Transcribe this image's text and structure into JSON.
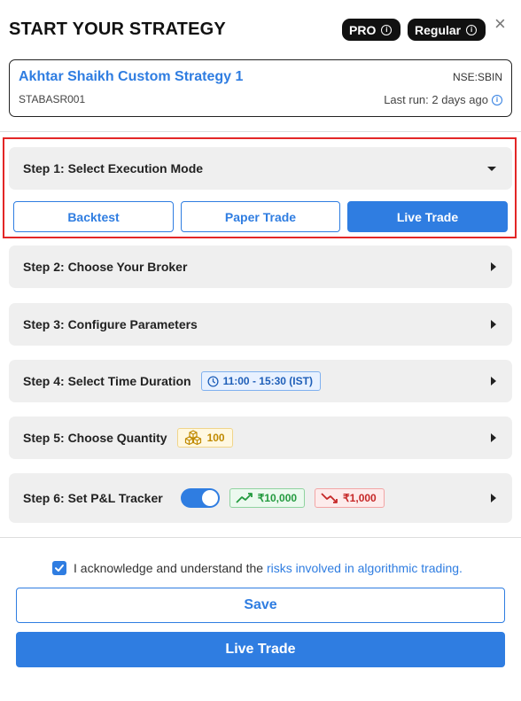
{
  "header": {
    "title": "START YOUR STRATEGY",
    "badge_pro": "PRO",
    "badge_regular": "Regular",
    "info_glyph": "i",
    "close_glyph": "×"
  },
  "strategy": {
    "name": "Akhtar Shaikh Custom Strategy 1",
    "symbol": "NSE:SBIN",
    "code": "STABASR001",
    "last_run": "Last run: 2 days ago"
  },
  "steps": {
    "step1": {
      "label": "Step 1: Select Execution Mode",
      "expanded": true
    },
    "step2": {
      "label": "Step 2: Choose Your Broker"
    },
    "step3": {
      "label": "Step 3: Configure Parameters"
    },
    "step4": {
      "label": "Step 4: Select Time Duration",
      "time_range": "11:00 - 15:30 (IST)"
    },
    "step5": {
      "label": "Step 5: Choose Quantity",
      "quantity": "100"
    },
    "step6": {
      "label": "Step 6: Set P&L Tracker",
      "tracker_enabled": true,
      "profit_target": "₹10,000",
      "stop_loss": "₹1,000"
    }
  },
  "execution_modes": {
    "backtest": "Backtest",
    "paper_trade": "Paper Trade",
    "live_trade": "Live Trade",
    "selected": "Live Trade"
  },
  "acknowledgement": {
    "checked": true,
    "text": "I acknowledge and understand the",
    "link_text": "risks involved in algorithmic trading."
  },
  "actions": {
    "save_label": "Save",
    "live_trade_label": "Live Trade"
  },
  "colors": {
    "accent": "#2f7de1",
    "highlight_border": "#e32626",
    "profit": "#239a3f",
    "loss": "#c62828",
    "quantity": "#c08a00"
  },
  "icons": {
    "close": "close-icon",
    "info": "info-icon",
    "clock": "clock-icon",
    "boxes": "boxes-icon",
    "trend_up": "trend-up-icon",
    "trend_down": "trend-down-icon",
    "check": "check-icon"
  }
}
